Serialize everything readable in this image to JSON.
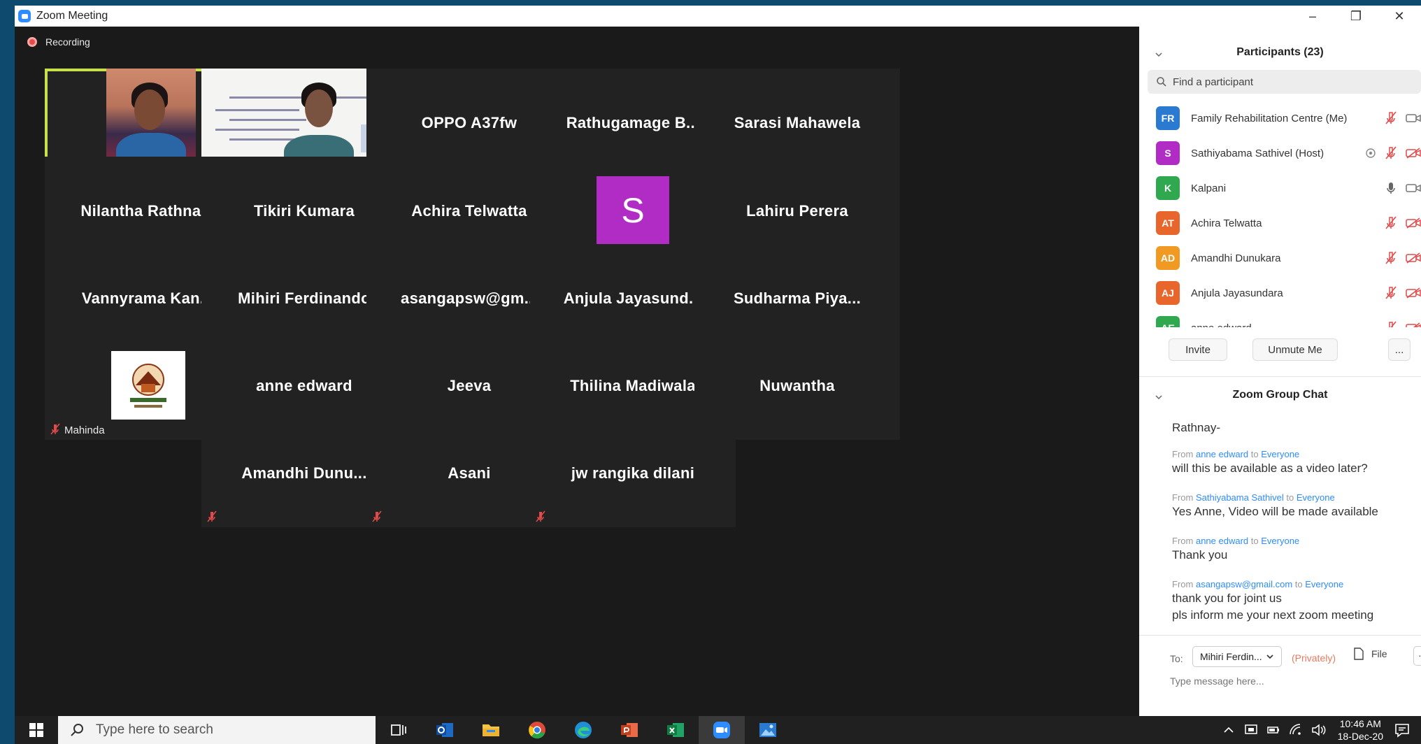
{
  "window": {
    "title": "Zoom Meeting",
    "minimize": "–",
    "restore": "❐",
    "close": "✕"
  },
  "recording": {
    "label": "Recording"
  },
  "tiles": [
    {
      "name": "",
      "label": "Kalpani",
      "kind": "video-kalpani",
      "active": true
    },
    {
      "name": "",
      "label": "Family Rehabilitation ...",
      "kind": "video-slide",
      "active": false
    },
    {
      "name": "OPPO A37fw",
      "label": "",
      "kind": "name"
    },
    {
      "name": "Rathugamage  B...",
      "label": "",
      "kind": "name"
    },
    {
      "name": "Sarasi Mahawela",
      "label": "",
      "kind": "name"
    },
    {
      "name": "Nilantha  Rathna...",
      "label": "",
      "kind": "name"
    },
    {
      "name": "Tikiri Kumara",
      "label": "",
      "kind": "name"
    },
    {
      "name": "Achira Telwatta",
      "label": "",
      "kind": "name"
    },
    {
      "name": "",
      "label": "Sathiyabama Sathivel",
      "kind": "avatar",
      "avatar_letter": "S"
    },
    {
      "name": "Lahiru Perera",
      "label": "",
      "kind": "name"
    },
    {
      "name": "Vannyrama  Kan...",
      "label": "",
      "kind": "name"
    },
    {
      "name": "Mihiri Ferdinando",
      "label": "",
      "kind": "name"
    },
    {
      "name": "asangapsw@gm...",
      "label": "",
      "kind": "name"
    },
    {
      "name": "Anjula  Jayasund...",
      "label": "",
      "kind": "name"
    },
    {
      "name": "Sudharma  Piya...",
      "label": "",
      "kind": "name"
    },
    {
      "name": "",
      "label": "Mahinda",
      "kind": "logo"
    },
    {
      "name": "anne edward",
      "label": "",
      "kind": "name"
    },
    {
      "name": "Jeeva",
      "label": "",
      "kind": "name"
    },
    {
      "name": "Thilina Madiwala",
      "label": "",
      "kind": "name"
    },
    {
      "name": "Nuwantha",
      "label": "",
      "kind": "name"
    },
    {
      "name": "Amandhi  Dunu...",
      "label": "",
      "kind": "name"
    },
    {
      "name": "Asani",
      "label": "",
      "kind": "name"
    },
    {
      "name": "jw rangika dilani",
      "label": "",
      "kind": "name"
    }
  ],
  "participants": {
    "title": "Participants (23)",
    "search_placeholder": "Find a participant",
    "items": [
      {
        "initials": "FR",
        "color": "#2a7ad2",
        "name": "Family Rehabilitation Centre (Me)",
        "mic": "muted",
        "video": "on"
      },
      {
        "initials": "S",
        "color": "#b02cc4",
        "name": "Sathiyabama Sathivel (Host)",
        "mic": "muted",
        "video": "off",
        "share": true
      },
      {
        "initials": "K",
        "color": "#2fa84f",
        "name": "Kalpani",
        "mic": "on",
        "video": "on"
      },
      {
        "initials": "AT",
        "color": "#e8662c",
        "name": "Achira Telwatta",
        "mic": "muted",
        "video": "off"
      },
      {
        "initials": "AD",
        "color": "#f09a23",
        "name": "Amandhi Dunukara",
        "mic": "muted",
        "video": "off"
      },
      {
        "initials": "AJ",
        "color": "#e8662c",
        "name": "Anjula Jayasundara",
        "mic": "muted",
        "video": "off"
      },
      {
        "initials": "AE",
        "color": "#2fa84f",
        "name": "anne edward",
        "mic": "muted",
        "video": "off"
      }
    ],
    "invite_label": "Invite",
    "unmute_label": "Unmute Me",
    "more_label": "..."
  },
  "chat": {
    "title": "Zoom Group Chat",
    "partial_top": "Rathnay-",
    "messages": [
      {
        "from": "anne edward",
        "to": "Everyone",
        "lines": [
          "will this be available as a video later?"
        ]
      },
      {
        "from": "Sathiyabama Sathivel",
        "to": "Everyone",
        "lines": [
          "Yes Anne, Video will be made available"
        ]
      },
      {
        "from": "anne edward",
        "to": "Everyone",
        "lines": [
          "Thank you"
        ]
      },
      {
        "from": "asangapsw@gmail.com",
        "to": "Everyone",
        "lines": [
          "thank you for joint us",
          "pls inform me your next zoom meeting"
        ]
      }
    ],
    "from_word": "From",
    "to_word": "to",
    "to_label": "To:",
    "recipient": "Mihiri Ferdin...",
    "privately": "(Privately)",
    "file_label": "File",
    "more_label": "···",
    "input_placeholder": "Type message here..."
  },
  "taskbar": {
    "search_placeholder": "Type here to search",
    "time": "10:46 AM",
    "date": "18-Dec-20"
  }
}
